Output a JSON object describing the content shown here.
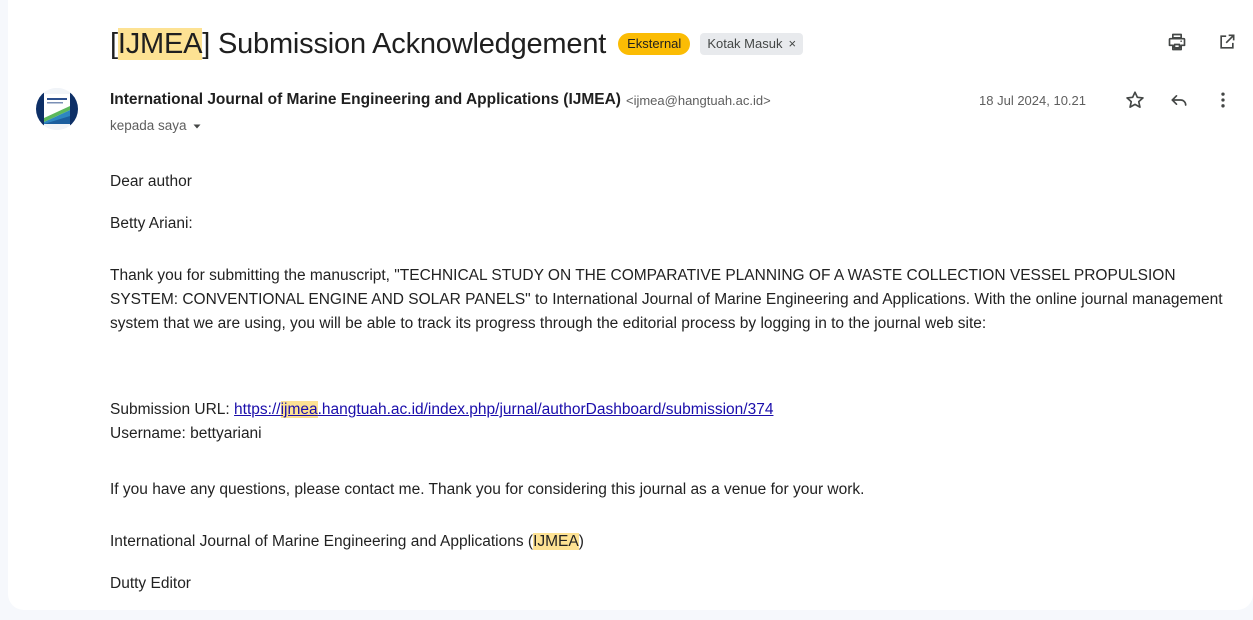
{
  "subject": {
    "prefix": "[",
    "highlight": "IJMEA",
    "rest": "] Submission Acknowledgement"
  },
  "labels": {
    "external": "Eksternal",
    "inbox": "Kotak Masuk",
    "inbox_remove": "×"
  },
  "sender": {
    "name": "International Journal of Marine Engineering and Applications (IJMEA)",
    "email": "<ijmea@hangtuah.ac.id>",
    "date": "18 Jul 2024, 10.21",
    "to": "kepada saya"
  },
  "body": {
    "greeting": "Dear author",
    "name": "Betty Ariani:",
    "main": "Thank you for submitting the manuscript, \"TECHNICAL STUDY ON THE COMPARATIVE PLANNING OF A WASTE COLLECTION VESSEL PROPULSION SYSTEM: CONVENTIONAL ENGINE AND SOLAR PANELS\" to International Journal of Marine Engineering and Applications. With the online journal management system that we are using, you will be able to track its progress through the editorial process by logging in to the journal web site:",
    "url_label": "Submission URL: ",
    "url_pre": "https://",
    "url_highlight": "ijmea",
    "url_post": ".hangtuah.ac.id/index.php/jurnal/authorDashboard/submission/374",
    "username": "Username: bettyariani",
    "questions": "If you have any questions, please contact me. Thank you for considering this journal as a venue for your work.",
    "journal_pre": "International Journal of Marine Engineering and Applications (",
    "journal_highlight": "IJMEA",
    "journal_post": ")",
    "signature": "Dutty Editor"
  },
  "icons": {
    "print": "print-icon",
    "open_new": "open-in-new-window-icon",
    "star": "star-icon",
    "reply": "reply-icon",
    "more": "more-vert-icon",
    "dropdown": "caret-down-icon"
  },
  "colors": {
    "highlight": "#fde293",
    "external_badge": "#fbbc04",
    "link": "#1a0dab"
  }
}
